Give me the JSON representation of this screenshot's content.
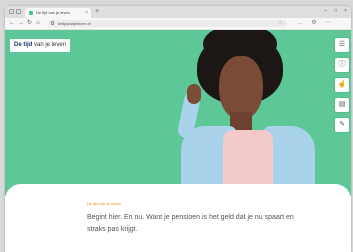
{
  "browser": {
    "tab_title": "De tijd van je leven",
    "tab_close": "×",
    "new_tab": "+",
    "url": "detijdvanjeleven.nl",
    "window_controls": {
      "minimize": "–",
      "maximize": "□",
      "close": "×"
    },
    "nav": {
      "back": "←",
      "forward": "→",
      "reload": "↻",
      "home": "⌂"
    },
    "bookmark": "☆",
    "toolbar_icons": [
      "…",
      "⚙",
      "⋯"
    ]
  },
  "site": {
    "logo_bold": "De tijd",
    "logo_rest": " van je leven"
  },
  "sidebar": {
    "items": [
      {
        "icon": "☰",
        "name": "menu-icon"
      },
      {
        "icon": "ⓘ",
        "name": "info-icon"
      },
      {
        "icon": "☝",
        "name": "hand-icon"
      },
      {
        "icon": "▤",
        "name": "print-icon"
      },
      {
        "icon": "✎",
        "name": "edit-icon"
      }
    ]
  },
  "content": {
    "kicker": "De tijd van je leven",
    "text_before": "Begint hier. En nu. Want je ",
    "text_link": "pensioen",
    "text_after": " is het geld dat je nu spaart en straks pas krijgt."
  },
  "colors": {
    "hero": "#5ec797",
    "accent": "#ff8a00",
    "logo": "#1a3a6b"
  }
}
